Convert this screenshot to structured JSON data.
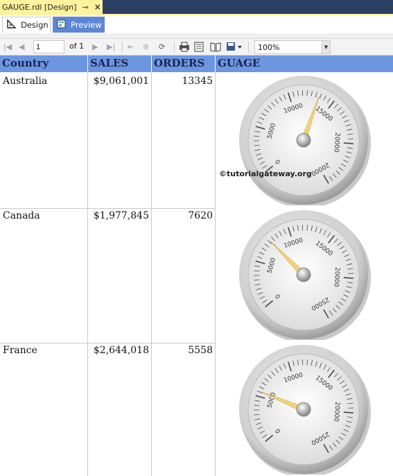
{
  "document_tab": {
    "title": "GAUGE.rdl [Design]",
    "pin_icon": "pin-icon",
    "close_icon": "close-icon",
    "close_glyph": "×",
    "pin_glyph": "⊸"
  },
  "mode_tabs": [
    {
      "label": "Design",
      "icon": "design-icon",
      "active": true
    },
    {
      "label": "Preview",
      "icon": "preview-icon",
      "active": false
    }
  ],
  "toolbar": {
    "page_value": "1",
    "page_of": "of 1",
    "zoom": "100%",
    "icons": [
      "first-page-icon",
      "previous-page-icon",
      "next-page-icon",
      "last-page-icon",
      "back-icon",
      "stop-icon",
      "refresh-icon",
      "print-icon",
      "print-layout-icon",
      "page-setup-icon",
      "export-icon"
    ]
  },
  "table": {
    "headers": [
      "Country",
      "SALES",
      "ORDERS",
      "GUAGE"
    ],
    "rows": [
      {
        "country": "Australia",
        "sales": "$9,061,001",
        "orders": "13345",
        "gauge_value": 13345
      },
      {
        "country": "Canada",
        "sales": "$1,977,845",
        "orders": "7620",
        "gauge_value": 7620
      },
      {
        "country": "France",
        "sales": "$2,644,018",
        "orders": "5558",
        "gauge_value": 5558
      }
    ]
  },
  "gauge_scales": [
    {
      "labels": [
        "0",
        "5000",
        "10000",
        "15000",
        "20000",
        "20000"
      ],
      "min": 0,
      "max": 25000
    },
    {
      "labels": [
        "0",
        "5000",
        "10000",
        "15000",
        "20000",
        "25000"
      ],
      "min": 0,
      "max": 25000
    },
    {
      "labels": [
        "0",
        "5000",
        "10000",
        "15000",
        "20000",
        "25000"
      ],
      "min": 0,
      "max": 25000
    }
  ],
  "watermark": "©tutorialgateway.org",
  "colors": {
    "header_bg": "#6d96e0",
    "header_text": "#1a2550",
    "doc_tab_bg": "#fff29d",
    "doc_strip": "#2b3e63",
    "preview_tab": "#5d87d6",
    "needle": "#f3d27a"
  }
}
